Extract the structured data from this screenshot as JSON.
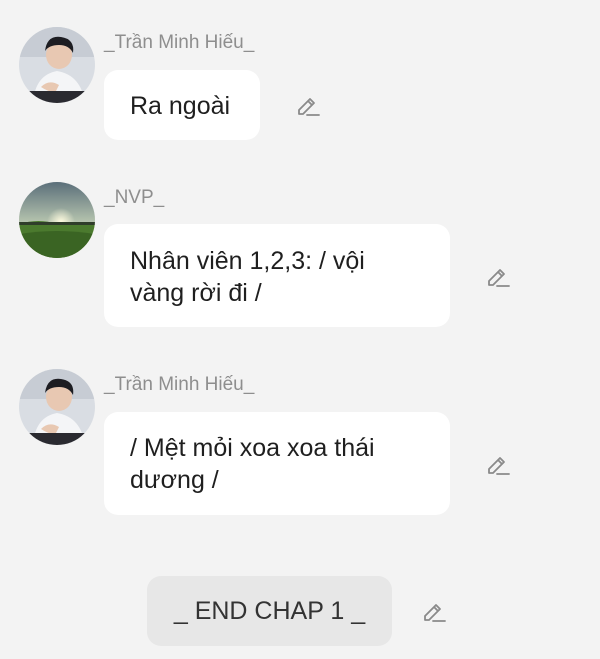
{
  "messages": [
    {
      "sender": "_Trần Minh Hiếu_",
      "avatar": "portrait-young-man-avatar",
      "text": "Ra ngoài",
      "action_icon": "pencil-edit-icon"
    },
    {
      "sender": "_NVP_",
      "avatar": "landscape-sunset-field-avatar",
      "text": "Nhân viên 1,2,3: / vội vàng rời đi /",
      "action_icon": "pencil-edit-icon"
    },
    {
      "sender": "_Trần Minh Hiếu_",
      "avatar": "portrait-young-man-avatar",
      "text": "/ Mệt mỏi xoa xoa thái dương /",
      "action_icon": "pencil-edit-icon"
    }
  ],
  "end_marker": {
    "text": "_ END CHAP 1 _",
    "action_icon": "pencil-edit-icon"
  },
  "colors": {
    "background": "#f3f3f3",
    "bubble": "#ffffff",
    "end_pill": "#e7e7e7",
    "sender_text": "#8e8e8e",
    "message_text": "#1f1f1f",
    "icon": "#8a8a8a"
  }
}
